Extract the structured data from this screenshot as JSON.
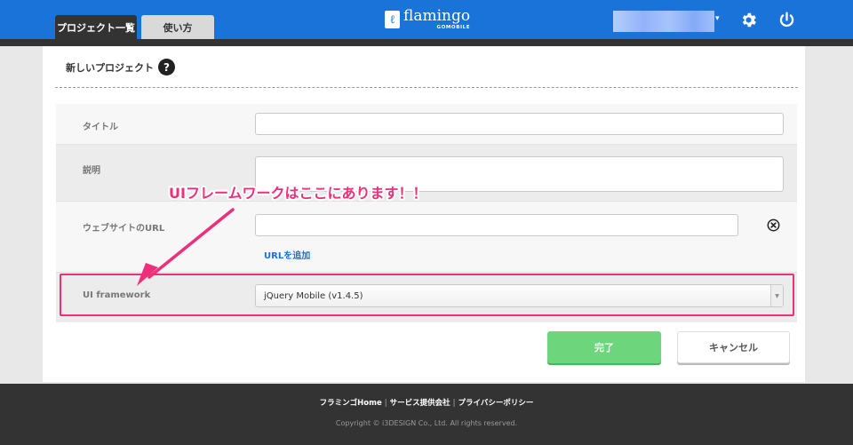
{
  "header": {
    "tabs": [
      {
        "label": "プロジェクト一覧",
        "active": true
      },
      {
        "label": "使い方",
        "active": false
      }
    ],
    "logo": {
      "mark": "ℓ",
      "name": "flamingo",
      "sub": "GOMOBILE"
    },
    "user_caret": "▾",
    "icons": [
      "gear-icon",
      "power-icon"
    ],
    "accent_color": "#1a73d9"
  },
  "page": {
    "title": "新しいプロジェクト",
    "help": "?"
  },
  "form": {
    "title_label": "タイトル",
    "title_value": "",
    "description_label": "説明",
    "description_value": "",
    "website_url_label": "ウェブサイトのURL",
    "website_url_value": "",
    "add_url_label": "URLを追加",
    "ui_framework_label": "UI framework",
    "ui_framework_selected": "jQuery Mobile (v1.4.5)"
  },
  "annotation": {
    "callout_text": "UIフレームワークはここにあります！！",
    "color": "#ee2f7a"
  },
  "actions": {
    "done_label": "完了",
    "cancel_label": "キャンセル"
  },
  "footer": {
    "links": [
      "フラミンゴHome",
      "サービス提供会社",
      "プライバシーポリシー"
    ],
    "separator": "|",
    "copyright": "Copyright © i3DESIGN Co., Ltd. All rights reserved."
  }
}
